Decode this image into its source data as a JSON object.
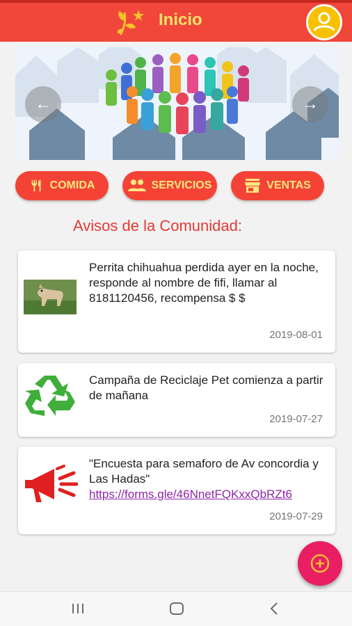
{
  "appbar": {
    "title": "Inicio",
    "logo_icon": "flower-star-logo-icon",
    "avatar_icon": "user-avatar-icon",
    "colors": {
      "bar": "#f0473a",
      "title": "#fbe36a",
      "avatar": "#f7c100"
    }
  },
  "banner": {
    "image": "community-people-houses-illustration",
    "prev_icon": "arrow-left-icon",
    "next_icon": "arrow-right-icon"
  },
  "categories": [
    {
      "label": "COMIDA",
      "icon": "utensils-icon"
    },
    {
      "label": "SERVICIOS",
      "icon": "people-icon"
    },
    {
      "label": "VENTAS",
      "icon": "store-icon"
    }
  ],
  "section_title": "Avisos de la Comunidad:",
  "notices": [
    {
      "text": "Perrita chihuahua perdida ayer en la noche, responde al nombre de fifi, llamar al 8181120456, recompensa $ $",
      "date": "2019-08-01",
      "image": "dog-photo"
    },
    {
      "text": "Campaña de Reciclaje Pet comienza a partir de mañana",
      "date": "2019-07-27",
      "image": "recycle-icon"
    },
    {
      "text": "\"Encuesta para semaforo de Av concordia y Las Hadas\"",
      "link": "https://forms.gle/46NnetFQKxxQbRZt6",
      "date": "2019-07-29",
      "image": "megaphone-icon"
    }
  ],
  "fab": {
    "icon": "add-circle-icon",
    "color": "#e91e63"
  },
  "navbar": {
    "recent_icon": "recent-apps-icon",
    "home_icon": "home-icon",
    "back_icon": "back-icon"
  }
}
